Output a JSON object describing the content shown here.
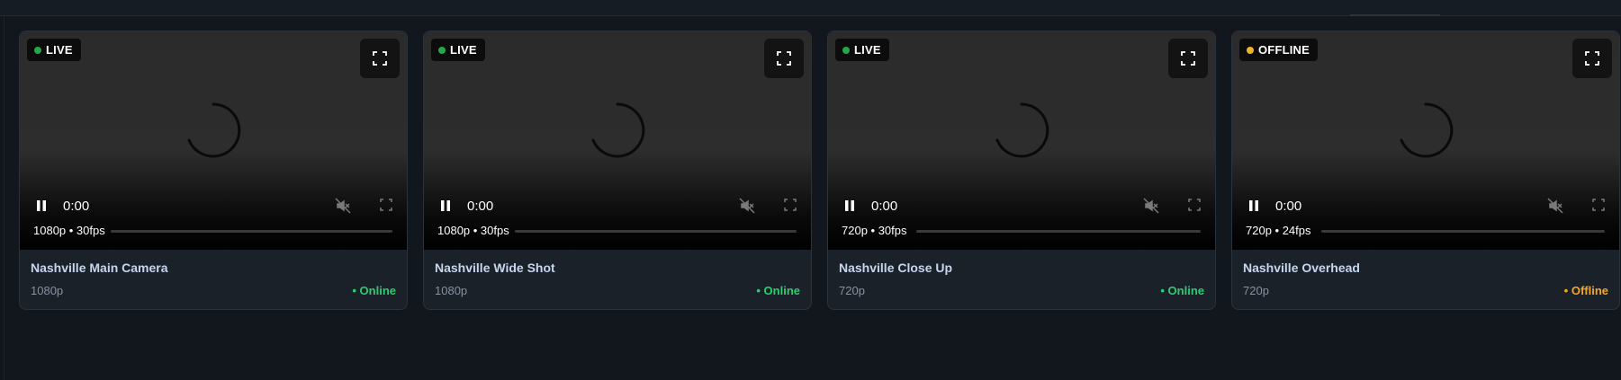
{
  "colors": {
    "live_dot": "#22a84a",
    "offline_dot": "#f0b429",
    "online_text": "#2ecc71",
    "offline_text": "#f5a623"
  },
  "cameras": [
    {
      "badge": "LIVE",
      "badge_state": "live",
      "time": "0:00",
      "resolution_fps": "1080p • 30fps",
      "name": "Nashville Main Camera",
      "quality": "1080p",
      "status": "• Online",
      "status_state": "online"
    },
    {
      "badge": "LIVE",
      "badge_state": "live",
      "time": "0:00",
      "resolution_fps": "1080p • 30fps",
      "name": "Nashville Wide Shot",
      "quality": "1080p",
      "status": "• Online",
      "status_state": "online"
    },
    {
      "badge": "LIVE",
      "badge_state": "live",
      "time": "0:00",
      "resolution_fps": "720p • 30fps",
      "name": "Nashville Close Up",
      "quality": "720p",
      "status": "• Online",
      "status_state": "online"
    },
    {
      "badge": "OFFLINE",
      "badge_state": "offline",
      "time": "0:00",
      "resolution_fps": "720p • 24fps",
      "name": "Nashville Overhead",
      "quality": "720p",
      "status": "• Offline",
      "status_state": "offline"
    }
  ],
  "icons": {
    "fullscreen": "fullscreen-icon",
    "pause": "pause-icon",
    "mute": "muted-speaker-icon",
    "spinner": "loading-spinner-icon"
  }
}
